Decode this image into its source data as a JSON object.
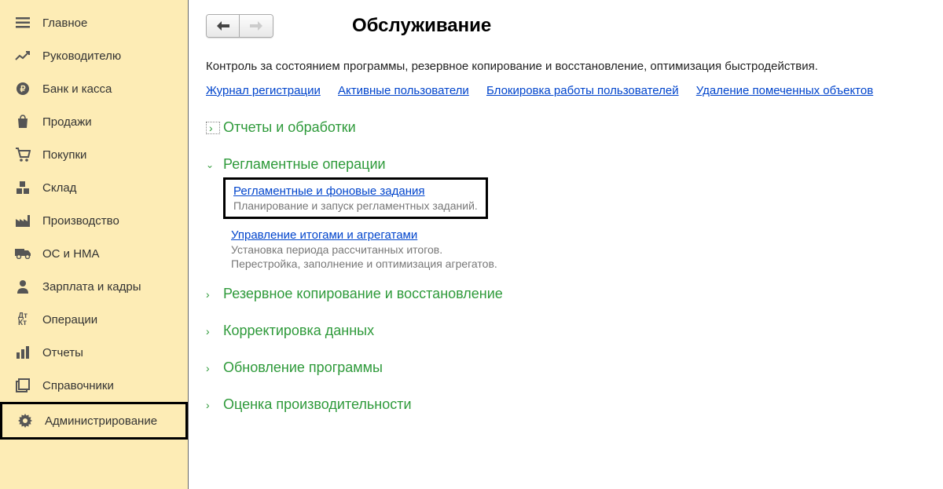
{
  "sidebar": {
    "items": [
      {
        "label": "Главное",
        "icon": "menu"
      },
      {
        "label": "Руководителю",
        "icon": "chart"
      },
      {
        "label": "Банк и касса",
        "icon": "ruble"
      },
      {
        "label": "Продажи",
        "icon": "bag"
      },
      {
        "label": "Покупки",
        "icon": "cart"
      },
      {
        "label": "Склад",
        "icon": "boxes"
      },
      {
        "label": "Производство",
        "icon": "factory"
      },
      {
        "label": "ОС и НМА",
        "icon": "truck"
      },
      {
        "label": "Зарплата и кадры",
        "icon": "person"
      },
      {
        "label": "Операции",
        "icon": "dtkt"
      },
      {
        "label": "Отчеты",
        "icon": "bars"
      },
      {
        "label": "Справочники",
        "icon": "books"
      },
      {
        "label": "Администрирование",
        "icon": "gear",
        "active": true
      }
    ]
  },
  "page": {
    "title": "Обслуживание",
    "description": "Контроль за состоянием программы, резервное копирование и восстановление, оптимизация быстродействия.",
    "quick_links": [
      "Журнал регистрации",
      "Активные пользователи",
      "Блокировка работы пользователей",
      "Удаление помеченных объектов"
    ],
    "sections": {
      "reports": {
        "title": "Отчеты и обработки",
        "expanded": false,
        "dotted": true
      },
      "scheduled": {
        "title": "Регламентные операции",
        "expanded": true,
        "item1_link": "Регламентные и фоновые задания",
        "item1_desc": "Планирование и запуск регламентных заданий.",
        "item2_link": "Управление итогами и агрегатами",
        "item2_desc1": "Установка периода рассчитанных итогов.",
        "item2_desc2": "Перестройка, заполнение и оптимизация агрегатов."
      },
      "backup": {
        "title": "Резервное копирование и восстановление"
      },
      "correction": {
        "title": "Корректировка данных"
      },
      "update": {
        "title": "Обновление программы"
      },
      "perf": {
        "title": "Оценка производительности"
      }
    }
  }
}
